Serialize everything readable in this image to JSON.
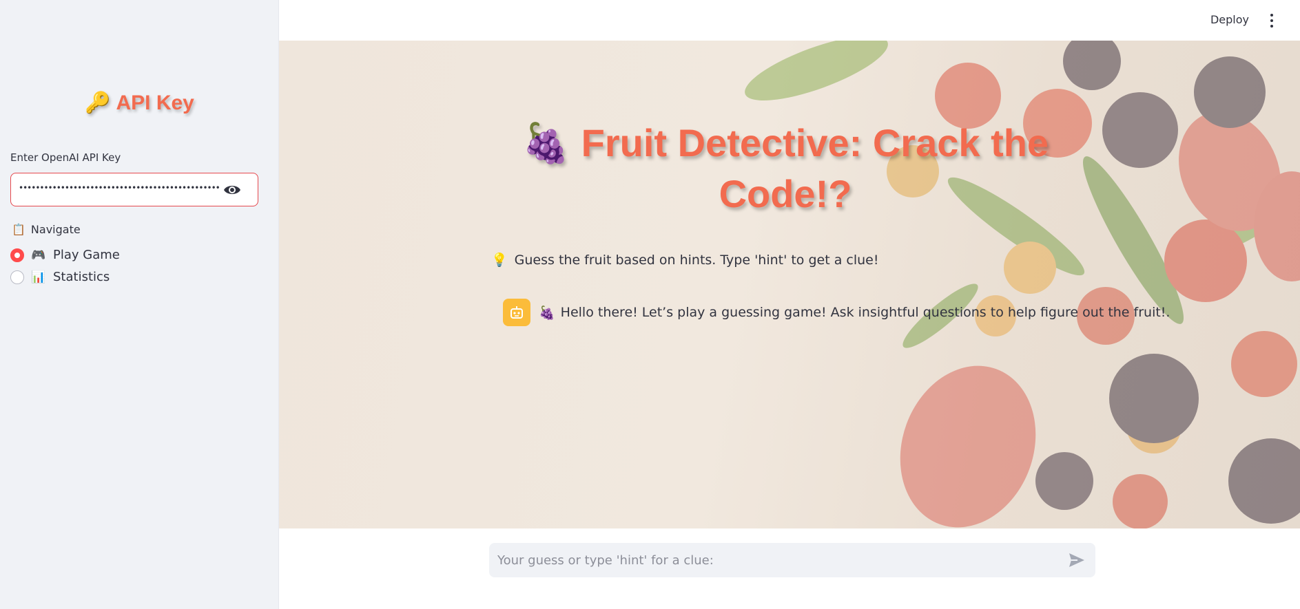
{
  "sidebar": {
    "title_icon": "🔑",
    "title": "API Key",
    "api_field_label": "Enter OpenAI API Key",
    "api_field_value": "••••••••••••••••••••••••••••••••••••••••••••••••••••••••",
    "nav_icon": "📋",
    "nav_label": "Navigate",
    "options": [
      {
        "icon": "🎮",
        "label": "Play Game",
        "selected": true
      },
      {
        "icon": "📊",
        "label": "Statistics",
        "selected": false
      }
    ]
  },
  "header": {
    "deploy_label": "Deploy"
  },
  "main": {
    "title_icon": "🍇",
    "title": "Fruit Detective: Crack the Code!?",
    "hint_icon": "💡",
    "hint": "Guess the fruit based on hints. Type 'hint' to get a clue!",
    "messages": [
      {
        "role": "assistant",
        "icon": "🍇",
        "text": "Hello there! Let’s play a guessing game! Ask insightful questions to help figure out the fruit!."
      }
    ]
  },
  "chat_input": {
    "placeholder": "Your guess or type 'hint' for a clue:"
  },
  "colors": {
    "accent": "#ff4b4b",
    "title": "#f26b4f",
    "avatar": "#fbbc3a",
    "sidebar_bg": "#f0f2f6"
  }
}
